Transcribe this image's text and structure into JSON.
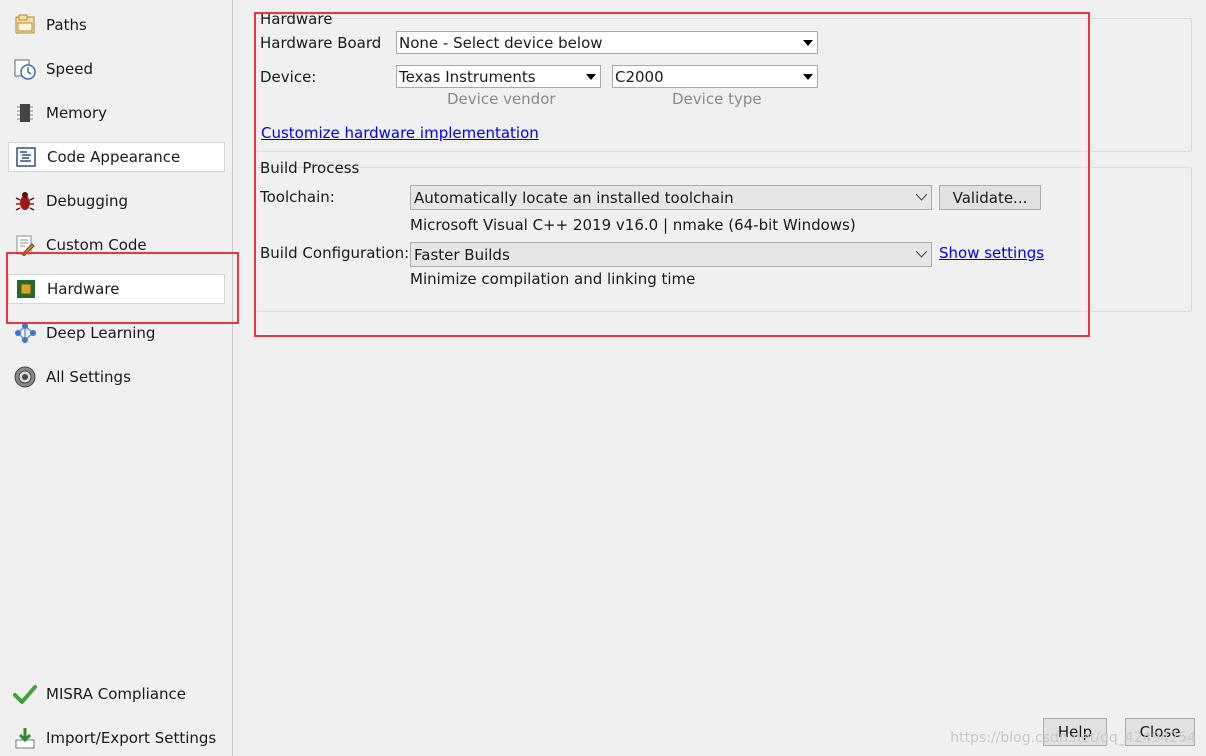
{
  "sidebar": {
    "items": [
      {
        "label": "Paths",
        "icon": "folder-icon"
      },
      {
        "label": "Speed",
        "icon": "clock-icon"
      },
      {
        "label": "Memory",
        "icon": "memory-icon"
      },
      {
        "label": "Code Appearance",
        "icon": "code-appearance-icon"
      },
      {
        "label": "Debugging",
        "icon": "bug-icon"
      },
      {
        "label": "Custom Code",
        "icon": "custom-code-icon"
      },
      {
        "label": "Hardware",
        "icon": "chip-icon"
      },
      {
        "label": "Deep Learning",
        "icon": "network-icon"
      },
      {
        "label": "All Settings",
        "icon": "gear-icon"
      },
      {
        "label": "MISRA Compliance",
        "icon": "checkmark-icon"
      },
      {
        "label": "Import/Export Settings",
        "icon": "import-export-icon"
      }
    ]
  },
  "hardware": {
    "title": "Hardware",
    "board_label": "Hardware Board",
    "board_value": "None - Select device below",
    "device_label": "Device:",
    "vendor_value": "Texas Instruments",
    "type_value": "C2000",
    "vendor_hint": "Device vendor",
    "type_hint": "Device type",
    "customize_link": "Customize hardware implementation"
  },
  "build": {
    "title": "Build Process",
    "toolchain_label": "Toolchain:",
    "toolchain_value": "Automatically locate an installed toolchain",
    "validate_button": "Validate...",
    "toolchain_info": "Microsoft Visual C++ 2019 v16.0 | nmake (64-bit Windows)",
    "config_label": "Build Configuration:",
    "config_value": "Faster Builds",
    "show_settings_link": "Show settings",
    "config_info": "Minimize compilation and linking time"
  },
  "footer": {
    "help_button": "Help",
    "close_button": "Close"
  },
  "watermark": "https://blog.csdn.net/qq_42494254",
  "colors": {
    "annotation_red": "#e8383d",
    "link": "#0000ee"
  }
}
